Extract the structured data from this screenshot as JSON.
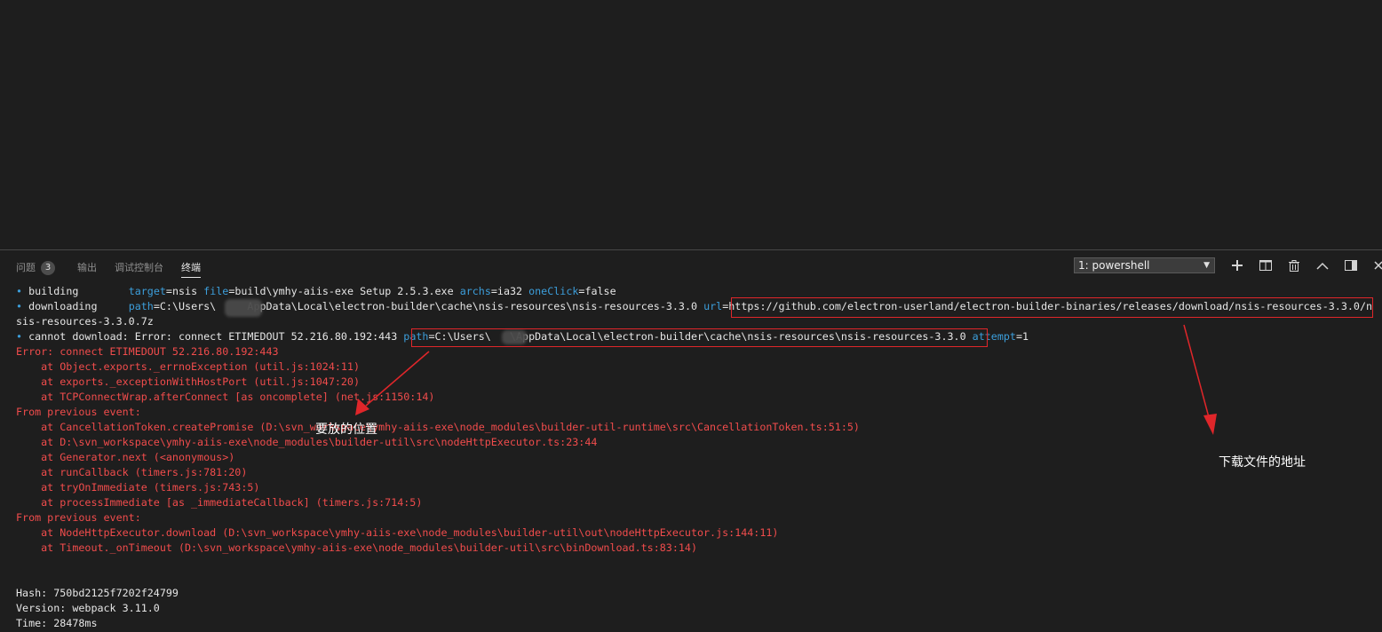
{
  "panel": {
    "tabs": [
      {
        "label": "问题",
        "badge": "3"
      },
      {
        "label": "输出"
      },
      {
        "label": "调试控制台"
      },
      {
        "label": "终端",
        "active": true
      }
    ],
    "terminal_selector": {
      "selected": "1: powershell"
    },
    "actions": [
      "plus-icon",
      "split-icon",
      "trash-icon",
      "chevron-up-icon",
      "maximize-icon",
      "close-icon"
    ]
  },
  "terminal": {
    "building": {
      "bullet": "•",
      "label": "building",
      "k1": "target",
      "v1": "=nsis",
      "k2": "file",
      "v2": "=build\\ymhy-aiis-exe Setup 2.5.3.exe",
      "k3": "archs",
      "v3": "=ia32",
      "k4": "oneClick",
      "v4": "=false"
    },
    "downloading": {
      "bullet": "•",
      "label": "downloading",
      "k1": "path",
      "v1a": "=C:\\Users\\",
      "v1b": "AppData\\Local\\electron-builder\\cache\\nsis-resources\\nsis-resources-3.3.0",
      "k2": "url",
      "v2": "=https://github.com/electron-userland/electron-builder-binaries/releases/download/nsis-resources-3.3.0/n",
      "wrap": "sis-resources-3.3.0.7z"
    },
    "cannot": {
      "bullet": "•",
      "msg": "cannot download: Error: connect ETIMEDOUT 52.216.80.192:443",
      "k1": "path",
      "v1a": "=C:\\Users\\",
      "v1b": "\\AppData\\Local\\electron-builder\\cache\\nsis-resources\\nsis-resources-3.3.0",
      "k2": "attempt",
      "v2": "=1"
    },
    "error_lines": [
      "Error: connect ETIMEDOUT 52.216.80.192:443",
      "    at Object.exports._errnoException (util.js:1024:11)",
      "    at exports._exceptionWithHostPort (util.js:1047:20)",
      "    at TCPConnectWrap.afterConnect [as oncomplete] (net.js:1150:14)",
      "From previous event:",
      "    at CancellationToken.createPromise (D:\\svn_workspace\\ymhy-aiis-exe\\node_modules\\builder-util-runtime\\src\\CancellationToken.ts:51:5)",
      "    at D:\\svn_workspace\\ymhy-aiis-exe\\node_modules\\builder-util\\src\\nodeHttpExecutor.ts:23:44",
      "    at Generator.next (<anonymous>)",
      "    at runCallback (timers.js:781:20)",
      "    at tryOnImmediate (timers.js:743:5)",
      "    at processImmediate [as _immediateCallback] (timers.js:714:5)",
      "From previous event:",
      "    at NodeHttpExecutor.download (D:\\svn_workspace\\ymhy-aiis-exe\\node_modules\\builder-util\\out\\nodeHttpExecutor.js:144:11)",
      "    at Timeout._onTimeout (D:\\svn_workspace\\ymhy-aiis-exe\\node_modules\\builder-util\\src\\binDownload.ts:83:14)"
    ],
    "footer_lines": [
      "Hash: 750bd2125f7202f24799",
      "Version: webpack 3.11.0",
      "Time: 28478ms"
    ]
  },
  "annotations": {
    "place_label": "要放的位置",
    "download_label": "下载文件的地址",
    "color": "#e0262a"
  }
}
